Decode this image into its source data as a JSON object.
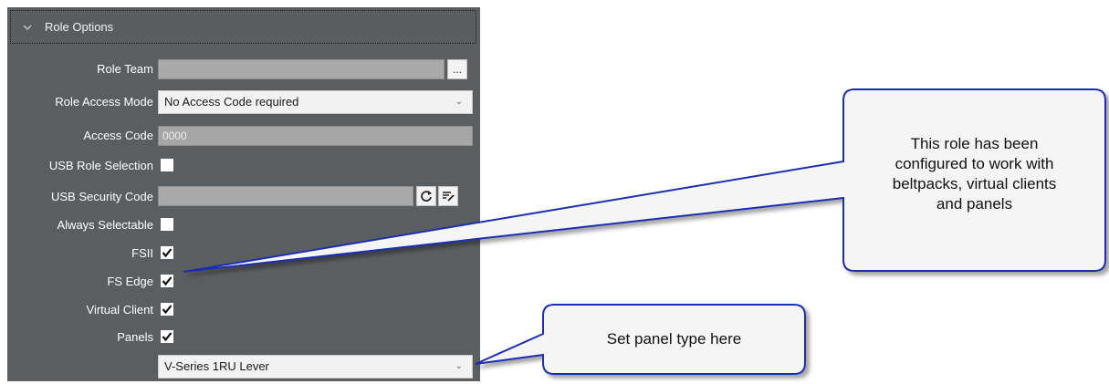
{
  "section": {
    "title": "Role Options",
    "collapse_icon": "chevron-down-icon"
  },
  "rows": {
    "role_team": {
      "label": "Role Team",
      "value": "",
      "browse_label": "..."
    },
    "role_access_mode": {
      "label": "Role Access Mode",
      "value": "No Access Code required"
    },
    "access_code": {
      "label": "Access Code",
      "value": "0000"
    },
    "usb_role_selection": {
      "label": "USB Role Selection",
      "checked": false
    },
    "usb_security_code": {
      "label": "USB Security Code",
      "value": "",
      "refresh_icon": "refresh-icon",
      "edit_icon": "edit-list-icon"
    },
    "always_selectable": {
      "label": "Always Selectable",
      "checked": false
    },
    "fsii": {
      "label": "FSII",
      "checked": true
    },
    "fs_edge": {
      "label": "FS Edge",
      "checked": true
    },
    "virtual_client": {
      "label": "Virtual Client",
      "checked": true
    },
    "panels": {
      "label": "Panels",
      "checked": true
    },
    "panel_type": {
      "value": "V-Series 1RU Lever"
    }
  },
  "callouts": {
    "role_config": {
      "line1": "This role has been",
      "line2": "configured to work with",
      "line3": "beltpacks, virtual clients",
      "line4": "and panels"
    },
    "panel_type": {
      "text": "Set panel type here"
    }
  },
  "colors": {
    "panel_bg": "#5b5e61",
    "callout_border": "#1f2fb0",
    "callout_fill": "#f5f5f5"
  }
}
